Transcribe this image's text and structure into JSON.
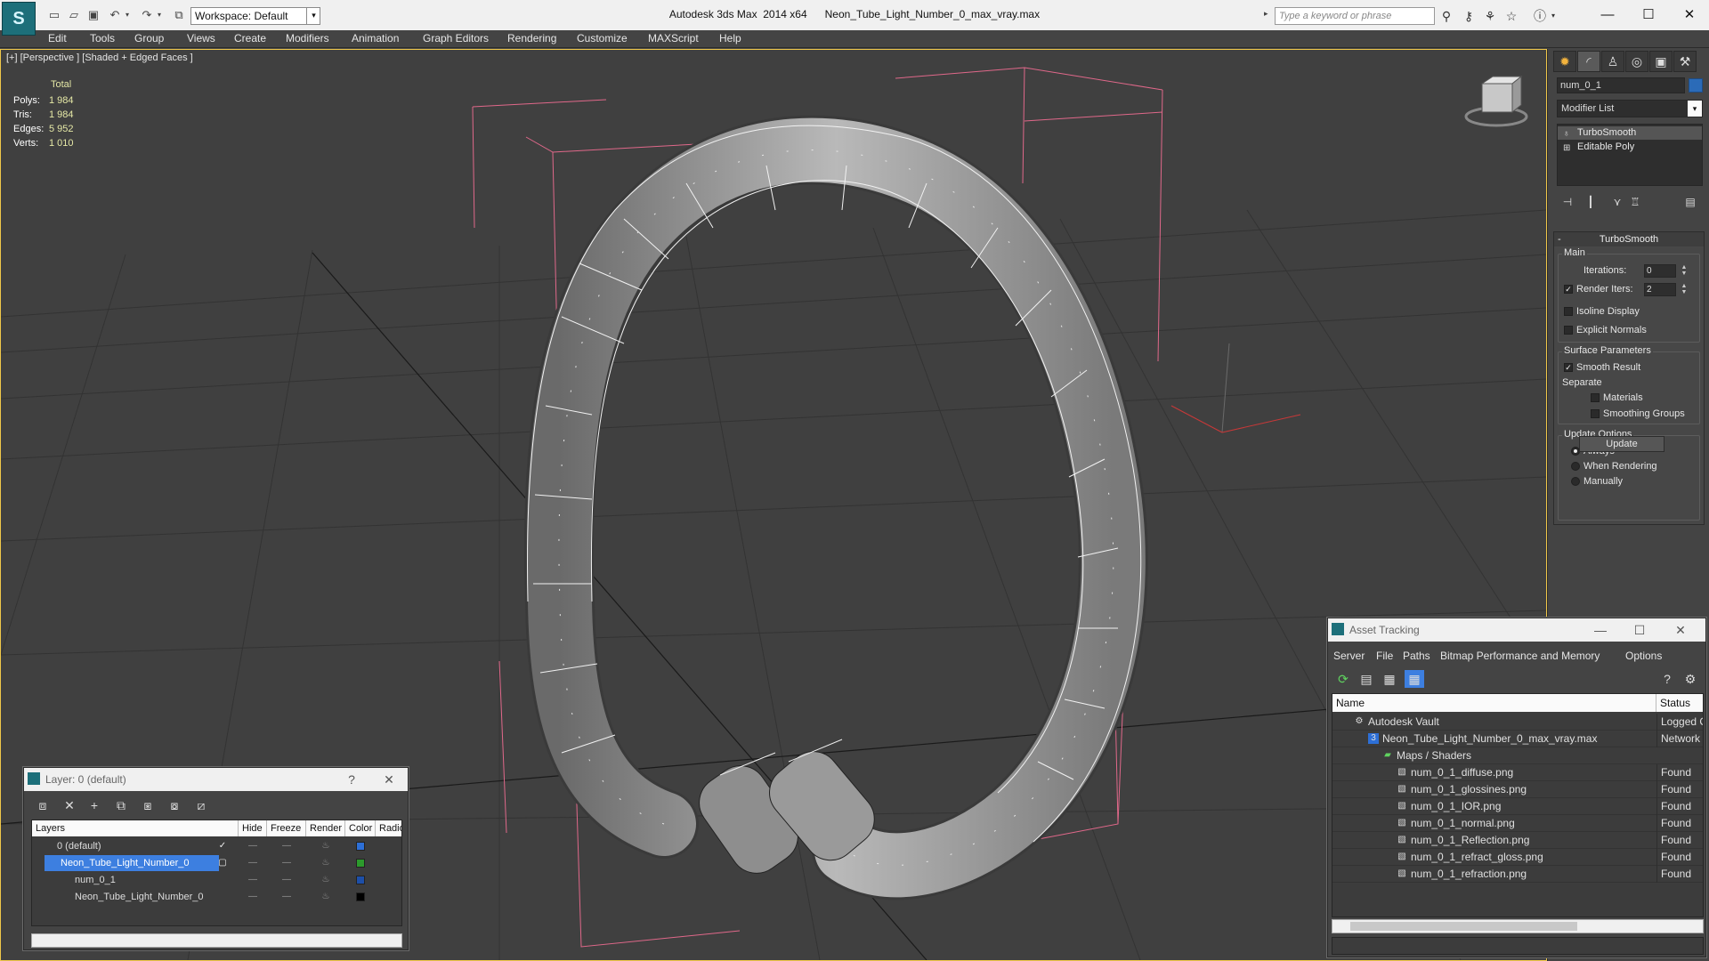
{
  "titlebar": {
    "workspace": "Workspace: Default",
    "title": "Autodesk 3ds Max  2014 x64      Neon_Tube_Light_Number_0_max_vray.max",
    "search_placeholder": "Type a keyword or phrase"
  },
  "menu": [
    "Edit",
    "Tools",
    "Group",
    "Views",
    "Create",
    "Modifiers",
    "Animation",
    "Graph Editors",
    "Rendering",
    "Customize",
    "MAXScript",
    "Help"
  ],
  "viewport": {
    "label": "[+] [Perspective ] [Shaded + Edged Faces ]",
    "stats": {
      "header": "Total",
      "rows": [
        {
          "label": "Polys:",
          "value": "1 984"
        },
        {
          "label": "Tris:",
          "value": "1 984"
        },
        {
          "label": "Edges:",
          "value": "5 952"
        },
        {
          "label": "Verts:",
          "value": "1 010"
        }
      ]
    }
  },
  "command_panel": {
    "object_name": "num_0_1",
    "object_color": "#2b6bb8",
    "modifier_list": "Modifier List",
    "stack": [
      "TurboSmooth",
      "Editable Poly"
    ],
    "turbosmooth": {
      "title": "TurboSmooth",
      "main_label": "Main",
      "iterations_label": "Iterations:",
      "iterations": "0",
      "render_iters_label": "Render Iters:",
      "render_iters": "2",
      "isoline": "Isoline Display",
      "explicit": "Explicit Normals",
      "surface_label": "Surface Parameters",
      "smooth_result": "Smooth Result",
      "separate_label": "Separate",
      "materials": "Materials",
      "smoothing_groups": "Smoothing Groups",
      "update_label": "Update Options",
      "always": "Always",
      "when_rendering": "When Rendering",
      "manually": "Manually",
      "update_button": "Update"
    }
  },
  "layer_dialog": {
    "title": "Layer: 0 (default)",
    "help": "?",
    "columns": [
      "Layers",
      "Hide",
      "Freeze",
      "Render",
      "Color",
      "Radio"
    ],
    "rows": [
      {
        "name": "0 (default)",
        "color": "#2d6fd6"
      },
      {
        "name": "Neon_Tube_Light_Number_0",
        "color": "#2c9a2c"
      },
      {
        "name": "num_0_1",
        "color": "#1d4fa8"
      },
      {
        "name": "Neon_Tube_Light_Number_0",
        "color": "#000000"
      }
    ]
  },
  "asset_dialog": {
    "title": "Asset Tracking",
    "menu": [
      "Server",
      "File",
      "Paths",
      "Bitmap Performance and Memory",
      "Options"
    ],
    "columns": [
      "Name",
      "Status"
    ],
    "rows": [
      {
        "name": "Autodesk Vault",
        "status": "Logged O"
      },
      {
        "name": "Neon_Tube_Light_Number_0_max_vray.max",
        "status": "Network P"
      },
      {
        "name": "Maps / Shaders",
        "status": ""
      },
      {
        "name": "num_0_1_diffuse.png",
        "status": "Found"
      },
      {
        "name": "num_0_1_glossines.png",
        "status": "Found"
      },
      {
        "name": "num_0_1_IOR.png",
        "status": "Found"
      },
      {
        "name": "num_0_1_normal.png",
        "status": "Found"
      },
      {
        "name": "num_0_1_Reflection.png",
        "status": "Found"
      },
      {
        "name": "num_0_1_refract_gloss.png",
        "status": "Found"
      },
      {
        "name": "num_0_1_refraction.png",
        "status": "Found"
      }
    ]
  },
  "accent_color": "#f0c84a"
}
